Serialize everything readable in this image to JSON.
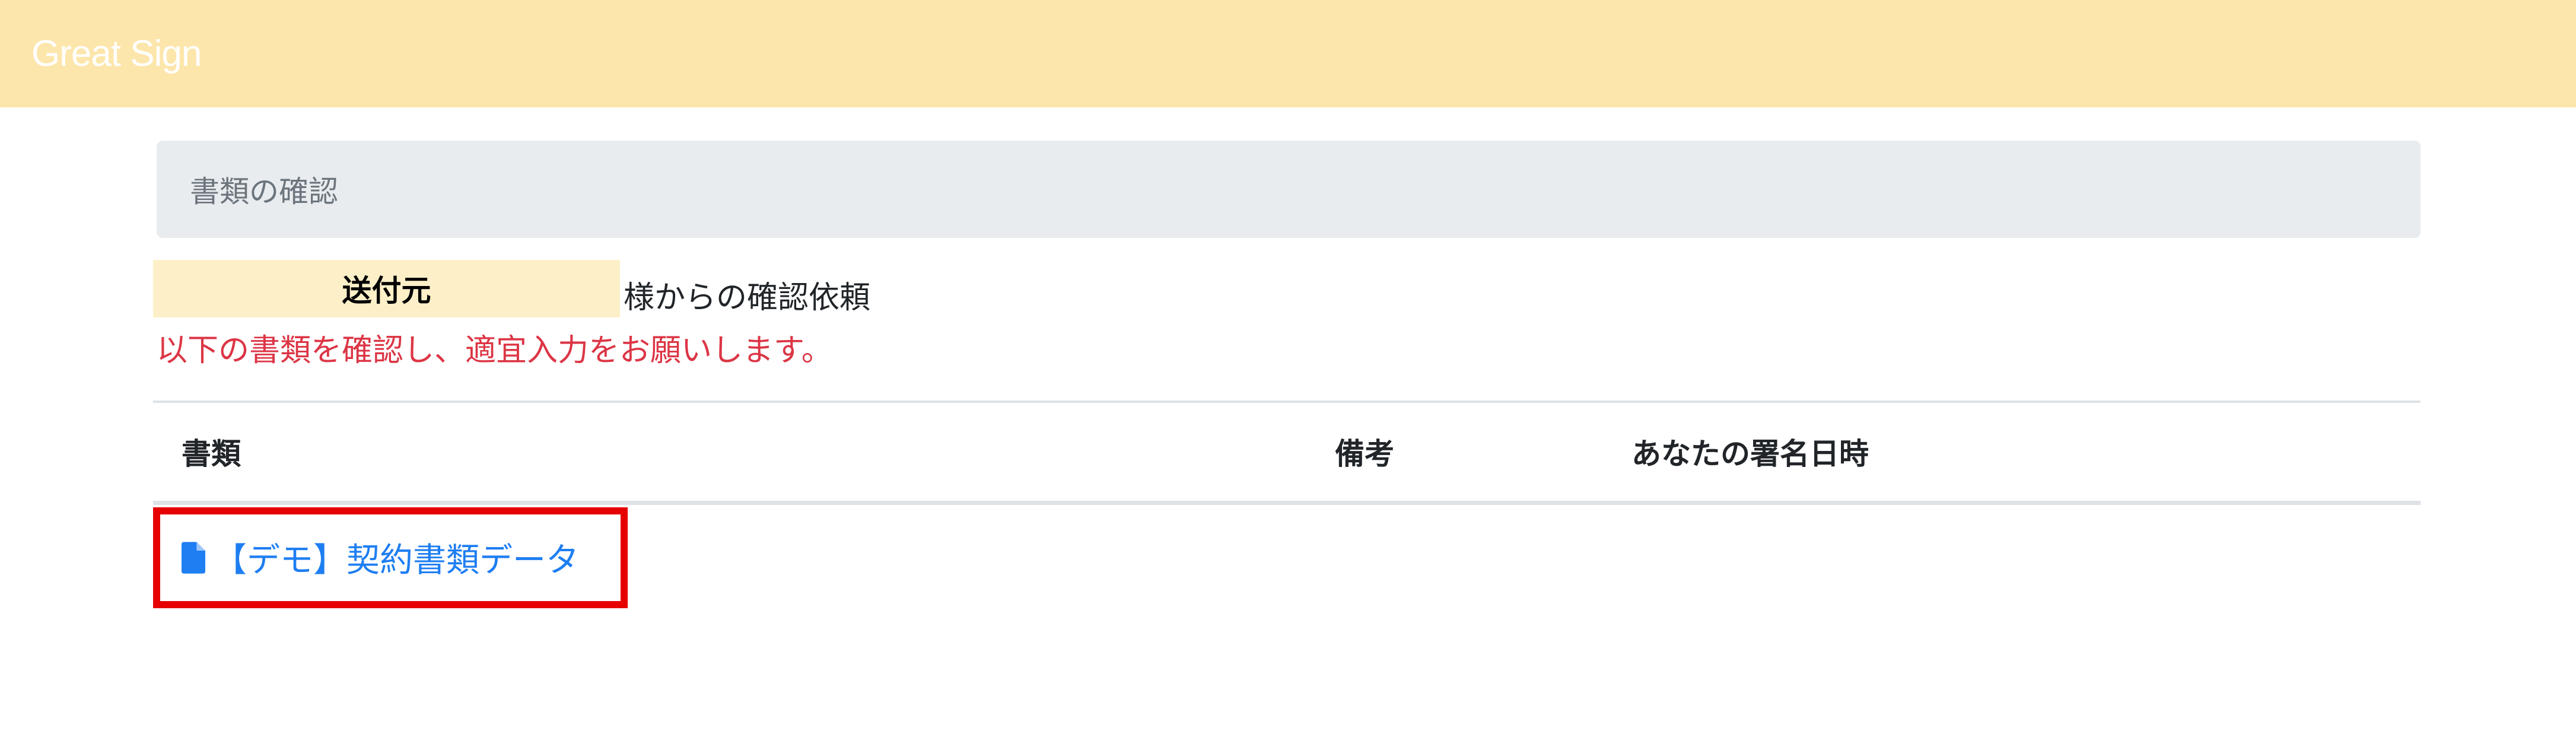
{
  "app": {
    "brand": "Great Sign",
    "accent_color": "#fde6ac"
  },
  "breadcrumb": {
    "current": "書類の確認"
  },
  "request": {
    "sender_label": "送付元",
    "sender_suffix": "様からの確認依頼",
    "instruction": "以下の書類を確認し、適宜入力をお願いします。"
  },
  "table": {
    "headers": {
      "document": "書類",
      "remarks": "備考",
      "signed_at": "あなたの署名日時"
    },
    "rows": [
      {
        "icon": "file-icon",
        "document": "【デモ】契約書類データ",
        "remarks": "",
        "signed_at": ""
      }
    ]
  }
}
